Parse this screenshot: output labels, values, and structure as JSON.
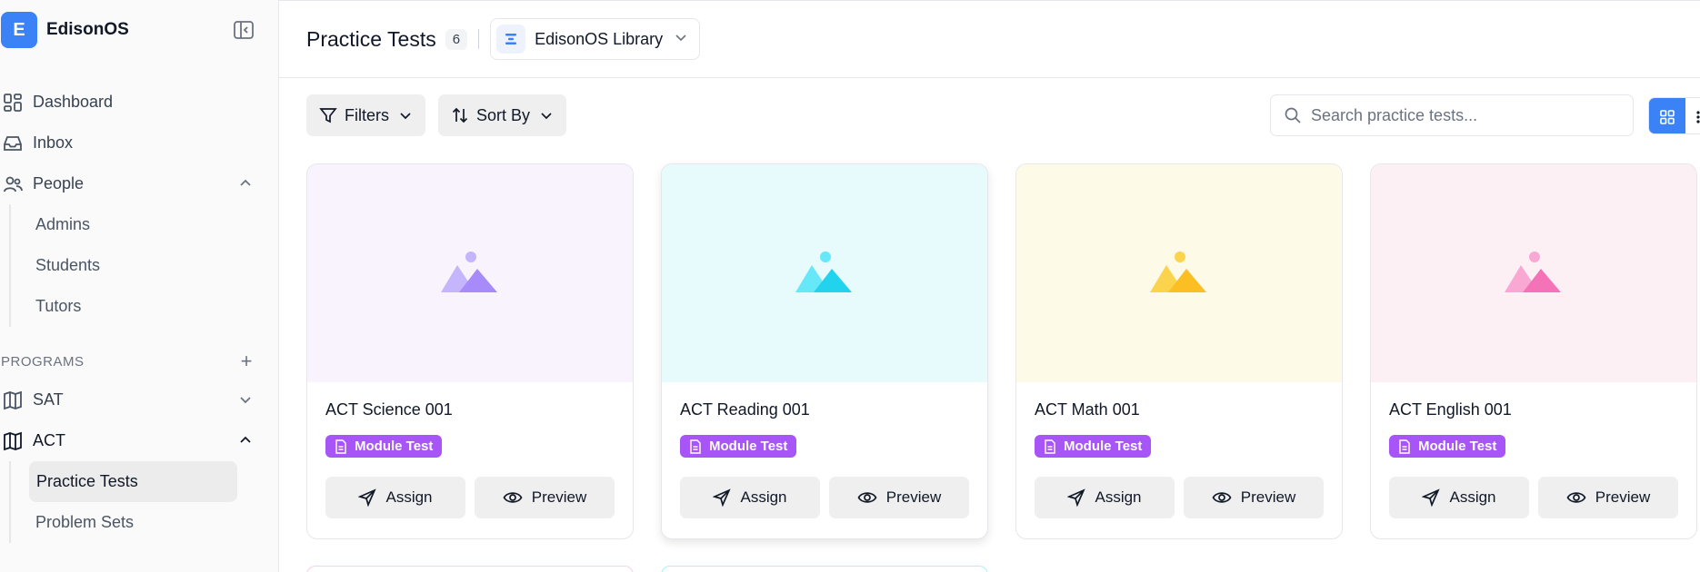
{
  "app": {
    "logo_letter": "E",
    "name": "EdisonOS"
  },
  "sidebar": {
    "nav": [
      {
        "label": "Dashboard",
        "icon": "dashboard-icon"
      },
      {
        "label": "Inbox",
        "icon": "inbox-icon"
      },
      {
        "label": "People",
        "icon": "people-icon",
        "expanded": true
      }
    ],
    "people_sub": [
      "Admins",
      "Students",
      "Tutors"
    ],
    "programs_title": "PROGRAMS",
    "programs": [
      {
        "label": "SAT",
        "icon": "book-icon",
        "expanded": false
      },
      {
        "label": "ACT",
        "icon": "book-icon",
        "expanded": true
      }
    ],
    "act_sub": [
      {
        "label": "Practice Tests",
        "active": true
      },
      {
        "label": "Problem Sets",
        "active": false
      }
    ]
  },
  "header": {
    "title": "Practice Tests",
    "count": "6",
    "library": "EdisonOS Library"
  },
  "toolbar": {
    "filters_label": "Filters",
    "sort_label": "Sort By",
    "search_placeholder": "Search practice tests...",
    "view_mode": "grid"
  },
  "cards": [
    {
      "title": "ACT Science 001",
      "badge": "Module Test",
      "bg": "#f8f3fd",
      "accent": "#a78bfa",
      "accent_light": "#c4b5fd",
      "assign": "Assign",
      "preview": "Preview"
    },
    {
      "title": "ACT Reading 001",
      "badge": "Module Test",
      "bg": "#e8fbfc",
      "accent": "#22d3ee",
      "accent_light": "#67e8f9",
      "assign": "Assign",
      "preview": "Preview"
    },
    {
      "title": "ACT Math 001",
      "badge": "Module Test",
      "bg": "#fdfbe8",
      "accent": "#fbbf24",
      "accent_light": "#fcd34d",
      "assign": "Assign",
      "preview": "Preview"
    },
    {
      "title": "ACT English 001",
      "badge": "Module Test",
      "bg": "#fdf0f5",
      "accent": "#f472b6",
      "accent_light": "#f9a8d4",
      "assign": "Assign",
      "preview": "Preview"
    }
  ],
  "colors": {
    "primary": "#3b82f6",
    "badge": "#a855f7"
  }
}
